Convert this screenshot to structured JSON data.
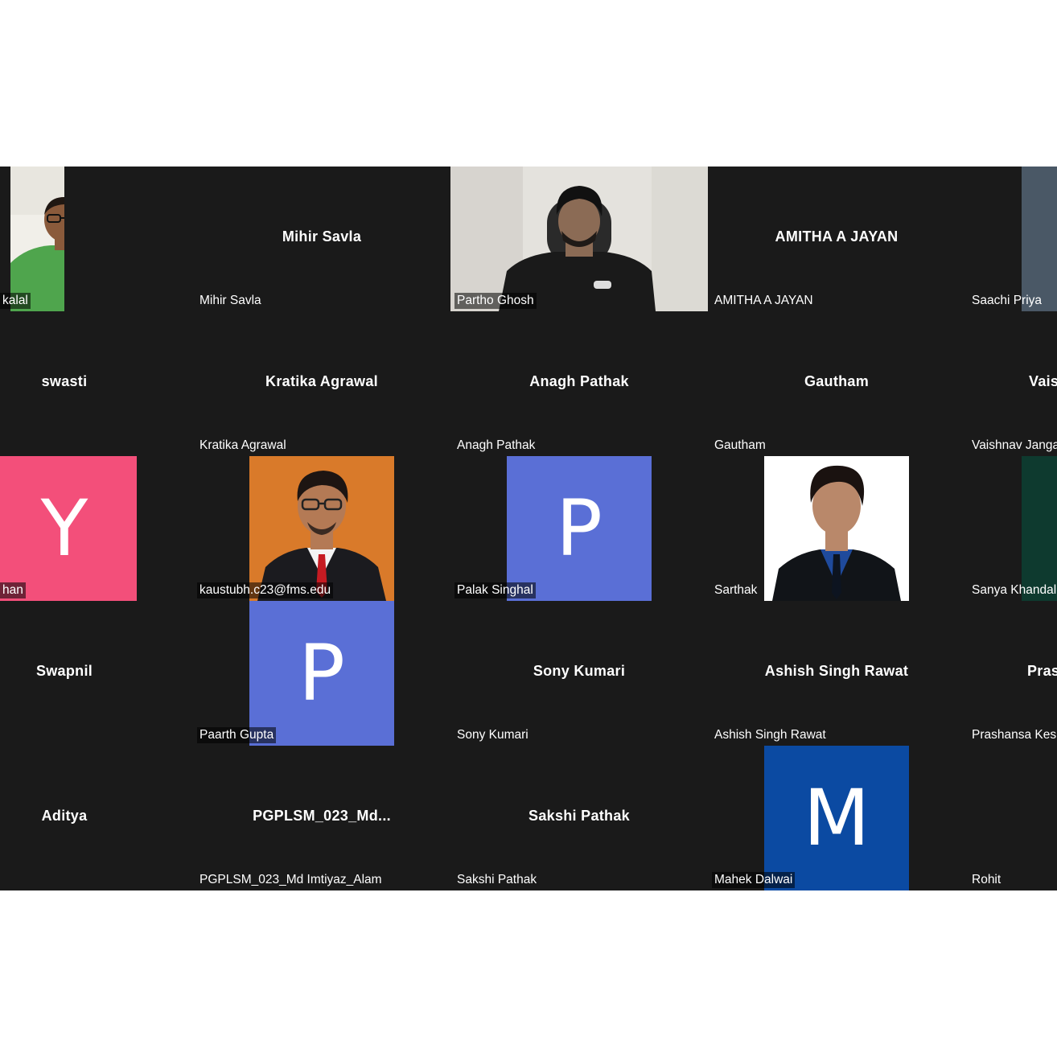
{
  "colors": {
    "grid_background": "#1a1a1a",
    "avatar_pink": "#f34f7a",
    "avatar_blue": "#5a6fd6",
    "avatar_darkblue": "#0b4aa2",
    "photo_orange": "#d97a2a"
  },
  "tiles": [
    {
      "label": "kalal"
    },
    {
      "title": "Mihir Savla",
      "label": "Mihir Savla"
    },
    {
      "label": "Partho Ghosh"
    },
    {
      "title": "AMITHA A JAYAN",
      "label": "AMITHA A JAYAN"
    },
    {
      "label": "Saachi Priya"
    },
    {
      "title": "swasti"
    },
    {
      "title": "Kratika Agrawal",
      "label": "Kratika Agrawal"
    },
    {
      "title": "Anagh Pathak",
      "label": "Anagh Pathak"
    },
    {
      "title": "Gautham",
      "label": "Gautham"
    },
    {
      "title": "Vais",
      "label": "Vaishnav Janga"
    },
    {
      "avatar": "Y",
      "label": "han"
    },
    {
      "label": "kaustubh.c23@fms.edu"
    },
    {
      "avatar": "P",
      "label": "Palak Singhal"
    },
    {
      "label": "Sarthak"
    },
    {
      "label": "Sanya Khandal"
    },
    {
      "title": "Swapnil"
    },
    {
      "avatar": "P",
      "label": "Paarth Gupta"
    },
    {
      "title": "Sony Kumari",
      "label": "Sony Kumari"
    },
    {
      "title": "Ashish Singh Rawat",
      "label": "Ashish Singh Rawat"
    },
    {
      "title": "Pras",
      "label": "Prashansa Kes"
    },
    {
      "title": "Aditya"
    },
    {
      "title": "PGPLSM_023_Md...",
      "label": "PGPLSM_023_Md Imtiyaz_Alam"
    },
    {
      "title": "Sakshi Pathak",
      "label": "Sakshi Pathak"
    },
    {
      "avatar": "M",
      "label": "Mahek Dalwai"
    },
    {
      "label": "Rohit"
    }
  ]
}
